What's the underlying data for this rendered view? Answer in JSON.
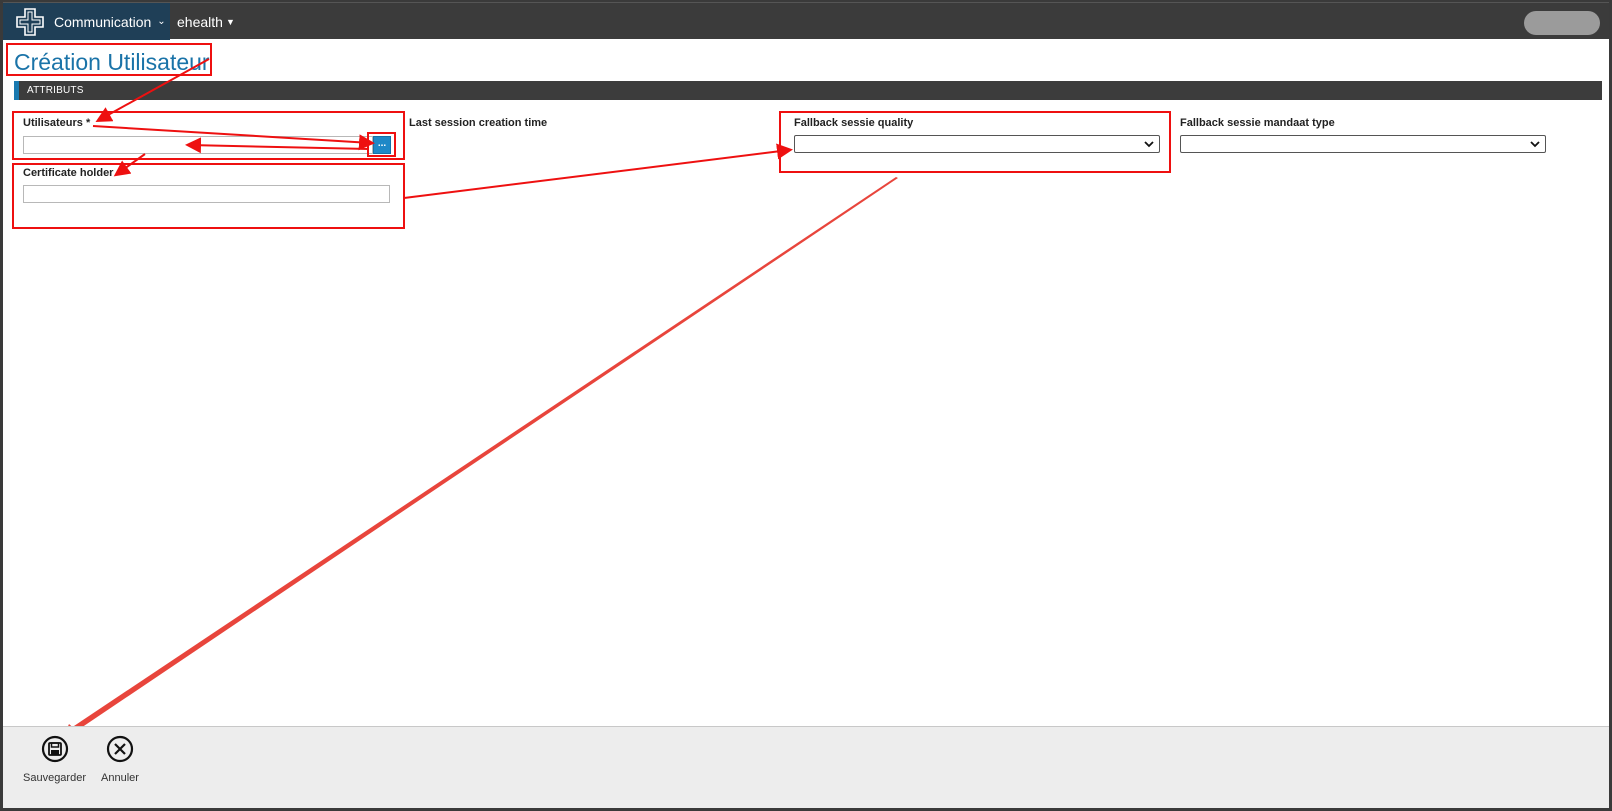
{
  "topbar": {
    "app_menu_label": "Communication",
    "nav_menu_label": "ehealth",
    "colors": {
      "bar": "#3b3b3b",
      "brand": "#1f3f57"
    }
  },
  "page": {
    "title": "Création Utilisateur",
    "section_label": "ATTRIBUTS"
  },
  "form": {
    "users_label": "Utilisateurs *",
    "users_value": "",
    "picker_label": "...",
    "certificate_label": "Certificate holder",
    "certificate_value": "",
    "last_session_label": "Last session creation time",
    "fallback_quality_label": "Fallback sessie quality",
    "fallback_quality_selected": "",
    "fallback_mandate_label": "Fallback sessie mandaat type",
    "fallback_mandate_selected": ""
  },
  "footer": {
    "save_label": "Sauvegarder",
    "cancel_label": "Annuler"
  },
  "icons": {
    "logo": "cross-logo-icon",
    "app_caret": "chevron-down-icon",
    "nav_caret": "caret-down-icon",
    "save": "floppy-disk-icon",
    "cancel": "close-circle-icon"
  },
  "annotation_color": "#ee1010",
  "accent_color": "#1a73a8"
}
